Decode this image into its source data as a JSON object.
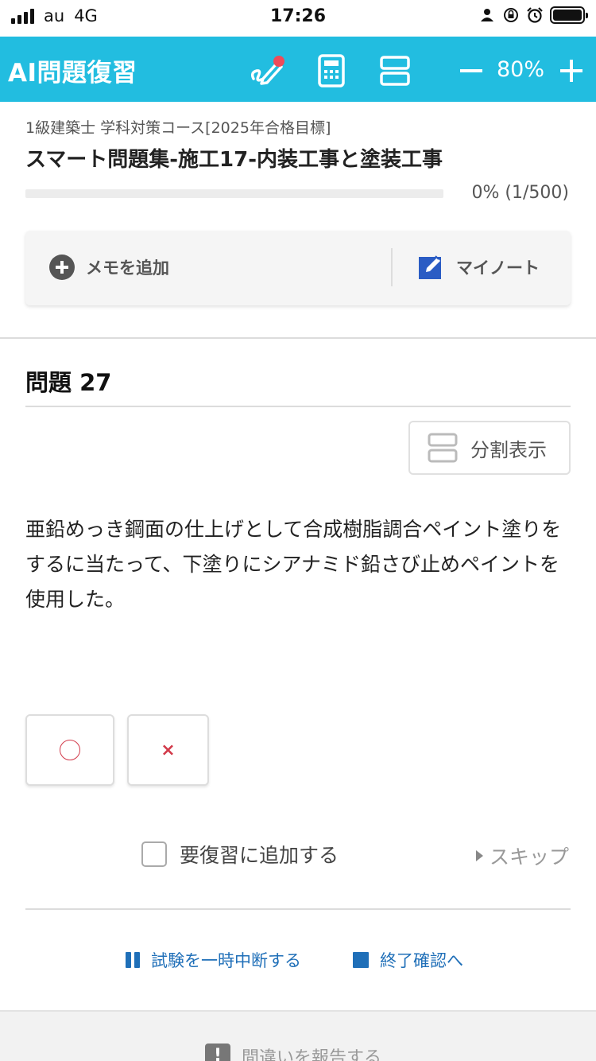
{
  "status_bar": {
    "carrier": "au",
    "network": "4G",
    "time": "17:26"
  },
  "header": {
    "title": "AI問題復習",
    "zoom": "80%",
    "accent_color": "#22bde0",
    "notification_dot_color": "#ee4b5a"
  },
  "course": {
    "subtitle": "1級建築士 学科対策コース[2025年合格目標]",
    "title": "スマート問題集-施工17-内装工事と塗装工事",
    "progress_text": "0% (1/500)",
    "progress_fraction": 0.0
  },
  "memo": {
    "add_label": "メモを追加",
    "my_note_label": "マイノート"
  },
  "question": {
    "number_label": "問題 27",
    "split_label": "分割表示",
    "text": "亜鉛めっき鋼面の仕上げとして合成樹脂調合ペイント塗りをするに当たって、下塗りにシアナミド鉛さび止めペイントを使用した。"
  },
  "answers": {
    "true_symbol": "circle",
    "false_symbol": "×",
    "mark_color": "#d23a4a"
  },
  "review": {
    "checkbox_label": "要復習に追加する",
    "skip_label": "スキップ"
  },
  "actions": {
    "pause_label": "試験を一時中断する",
    "end_label": "終了確認へ",
    "link_color": "#1f6fb8"
  },
  "footer": {
    "report_label": "間違いを報告する"
  }
}
